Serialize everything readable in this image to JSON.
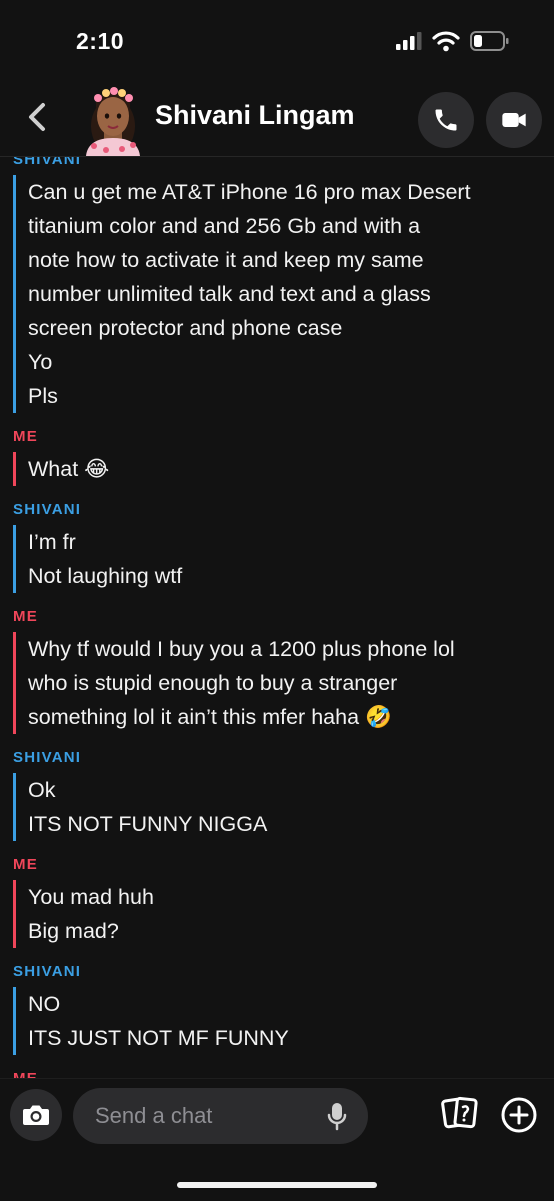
{
  "status_bar": {
    "time": "2:10"
  },
  "header": {
    "contact_name": "Shivani Lingam"
  },
  "messages": [
    {
      "sender": "SHIVANI",
      "lines": [
        "Can u get me AT&T  iPhone 16 pro max Desert",
        "titanium color and and 256 Gb  and with a",
        "note how to activate it and keep my same",
        "number unlimited talk and text and a glass",
        "screen protector and phone case",
        "Yo",
        "Pls"
      ]
    },
    {
      "sender": "ME",
      "lines": [
        "What 😂"
      ]
    },
    {
      "sender": "SHIVANI",
      "lines": [
        "I’m fr",
        "Not laughing wtf"
      ]
    },
    {
      "sender": "ME",
      "lines": [
        "Why tf would I buy you a 1200 plus phone lol",
        "who is stupid enough to buy a stranger",
        "something lol it ain’t this mfer haha 🤣"
      ]
    },
    {
      "sender": "SHIVANI",
      "lines": [
        "Ok",
        "ITS NOT FUNNY NIGGA"
      ]
    },
    {
      "sender": "ME",
      "lines": [
        "You mad huh",
        "Big mad?"
      ]
    },
    {
      "sender": "SHIVANI",
      "lines": [
        "NO",
        "ITS JUST NOT MF FUNNY"
      ]
    },
    {
      "sender": "ME",
      "lines": []
    }
  ],
  "composer": {
    "placeholder": "Send a chat"
  },
  "colors": {
    "shivani": "#3b9fe3",
    "me": "#f0465a",
    "background": "#121212"
  },
  "icons": {
    "back": "chevron-left-icon",
    "call": "phone-icon",
    "video": "video-camera-icon",
    "camera": "camera-icon",
    "mic": "microphone-icon",
    "cards": "cards-icon",
    "plus": "plus-circle-icon"
  }
}
